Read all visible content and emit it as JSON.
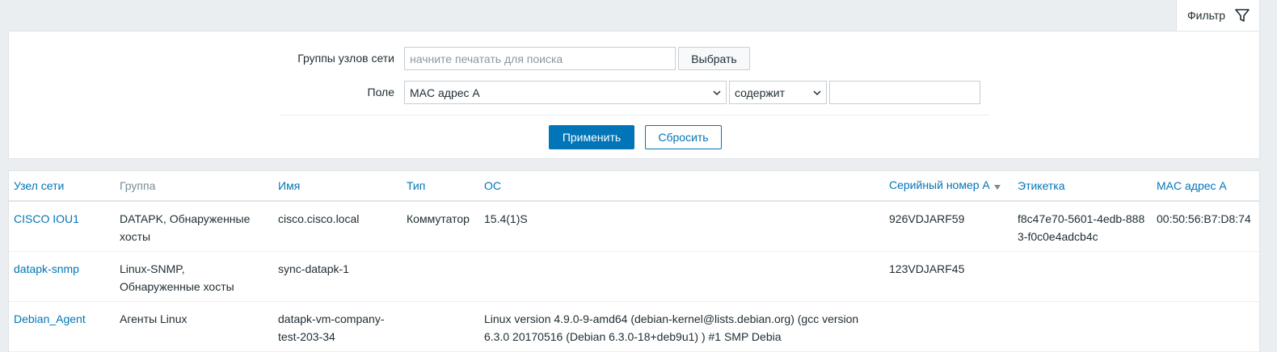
{
  "filter": {
    "tab_label": "Фильтр",
    "groups_label": "Группы узлов сети",
    "groups_placeholder": "начните печатать для поиска",
    "select_button": "Выбрать",
    "field_label": "Поле",
    "field_value": "MAC адрес A",
    "operator_value": "содержит",
    "search_value": "",
    "apply_button": "Применить",
    "reset_button": "Сбросить"
  },
  "table": {
    "headers": {
      "host": "Узел сети",
      "group": "Группа",
      "name": "Имя",
      "type": "Тип",
      "os": "ОС",
      "serial": "Серийный номер A",
      "tag": "Этикетка",
      "mac": "MAC адрес A"
    },
    "rows": [
      {
        "host": "CISCO IOU1",
        "group": "DATAPK, Обнаруженные хосты",
        "name": "cisco.cisco.local",
        "type": "Коммутатор",
        "os": "15.4(1)S",
        "serial": "926VDJARF59",
        "tag": "f8c47e70-5601-4edb-8883-f0c0e4adcb4c",
        "mac": "00:50:56:B7:D8:74"
      },
      {
        "host": "datapk-snmp",
        "group": "Linux-SNMP, Обнаруженные хосты",
        "name": "sync-datapk-1",
        "type": "",
        "os": "",
        "serial": "123VDJARF45",
        "tag": "",
        "mac": ""
      },
      {
        "host": "Debian_Agent",
        "group": "Агенты Linux",
        "name": "datapk-vm-company-test-203-34",
        "type": "",
        "os": "Linux version 4.9.0-9-amd64 (debian-kernel@lists.debian.org) (gcc version 6.3.0 20170516 (Debian 6.3.0-18+deb9u1) ) #1 SMP Debia",
        "serial": "",
        "tag": "",
        "mac": ""
      }
    ]
  },
  "colors": {
    "accent": "#0275b8",
    "background": "#ebeef0",
    "text": "#1f2c33"
  },
  "icons": {
    "filter": "funnel-icon",
    "dropdown": "chevron-down-icon",
    "sort": "sort-desc-icon"
  }
}
